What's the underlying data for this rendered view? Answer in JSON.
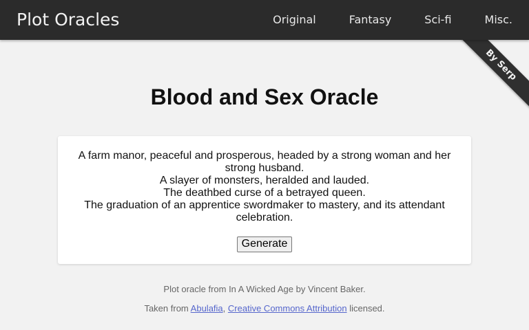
{
  "navbar": {
    "brand": "Plot Oracles",
    "links": [
      "Original",
      "Fantasy",
      "Sci-fi",
      "Misc."
    ]
  },
  "ribbon": {
    "label": "By Serp"
  },
  "page": {
    "title": "Blood and Sex Oracle"
  },
  "result": {
    "lines": [
      "A farm manor, peaceful and prosperous, headed by a strong woman and her strong husband.",
      "A slayer of monsters, heralded and lauded.",
      "The deathbed curse of a betrayed queen.",
      "The graduation of an apprentice swordmaker to mastery, and its attendant celebration."
    ],
    "generate_label": "Generate"
  },
  "footer": {
    "credit": "Plot oracle from In A Wicked Age by Vincent Baker.",
    "taken_from": "Taken from",
    "link_abulafia": "Abulafia",
    "comma": ",",
    "link_license": "Creative Commons Attribution",
    "licensed": "licensed."
  },
  "colors": {
    "navbar_bg": "#2b2b2b",
    "page_bg": "#f2f2f2",
    "link": "#5566cc"
  }
}
